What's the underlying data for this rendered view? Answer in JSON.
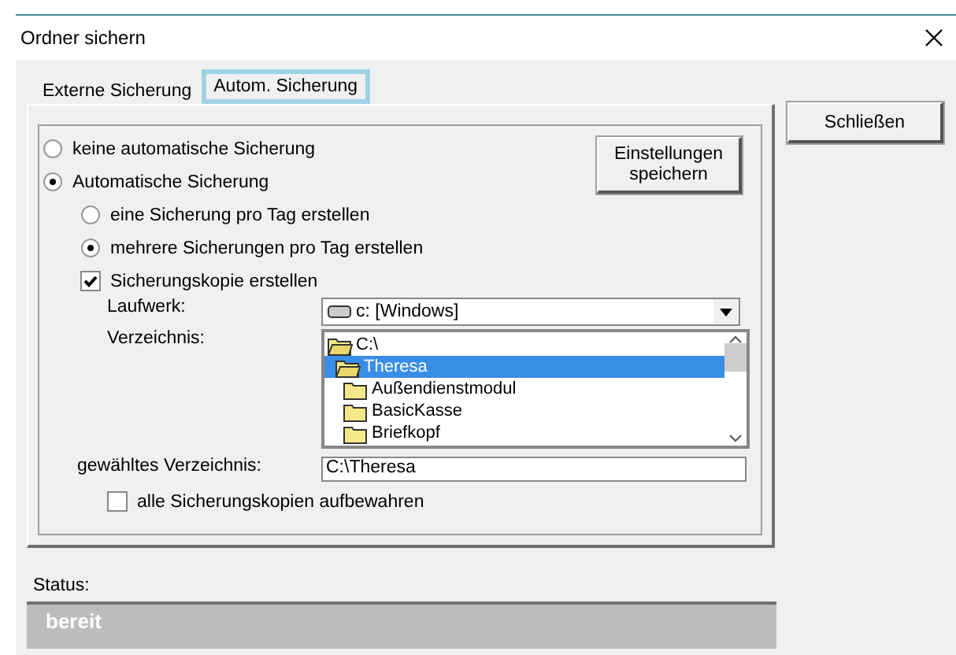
{
  "window": {
    "title": "Ordner sichern"
  },
  "tabs": [
    {
      "label": "Externe Sicherung",
      "selected": false
    },
    {
      "label": "Autom. Sicherung",
      "selected": true
    }
  ],
  "save_button": "Einstellungen speichern",
  "close_button": "Schließen",
  "options": [
    {
      "kind": "radio",
      "label": "keine automatische Sicherung",
      "selected": false
    },
    {
      "kind": "radio",
      "label": "Automatische Sicherung",
      "selected": true,
      "children": [
        {
          "kind": "radio",
          "label": "eine Sicherung pro Tag erstellen",
          "selected": false
        },
        {
          "kind": "radio",
          "label": "mehrere Sicherungen pro Tag erstellen",
          "selected": true
        },
        {
          "kind": "checkbox",
          "label": "Sicherungskopie erstellen",
          "checked": true
        }
      ]
    }
  ],
  "drive": {
    "label": "Laufwerk:",
    "value": "c: [Windows]"
  },
  "directory": {
    "label": "Verzeichnis:",
    "tree": [
      {
        "name": "C:\\",
        "expanded": true,
        "selected": false,
        "children": [
          {
            "name": "Theresa",
            "expanded": true,
            "selected": true,
            "children": [
              {
                "name": "Außendienstmodul",
                "expanded": false,
                "selected": false
              },
              {
                "name": "BasicKasse",
                "expanded": false,
                "selected": false
              },
              {
                "name": "Briefkopf",
                "expanded": false,
                "selected": false
              }
            ]
          }
        ]
      }
    ]
  },
  "chosen": {
    "label": "gewähltes Verzeichnis:",
    "value": "C:\\Theresa"
  },
  "keep_all": {
    "label": "alle Sicherungskopien aufbewahren",
    "checked": false
  },
  "status": {
    "label": "Status:",
    "value": "bereit"
  }
}
